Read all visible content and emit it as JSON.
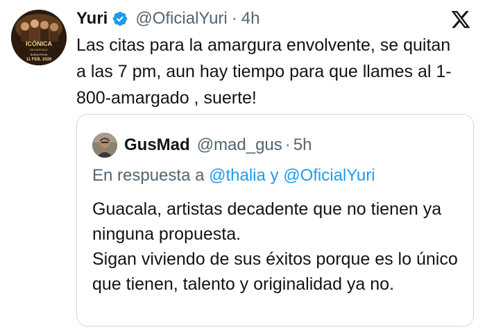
{
  "tweet": {
    "author_name": "Yuri",
    "author_handle": "@OficialYuri",
    "separator": "·",
    "time": "4h",
    "text": "Las citas para la amargura envolvente, se quitan a las 7 pm, aun hay tiempo para que llames al 1-800-amargado , suerte!",
    "avatar_text": {
      "line1": "ICÓNICA",
      "line2": "RECARGADO",
      "line3": "NUEVA FECHA",
      "line4": "11 FEB. 2026"
    },
    "verified_icon": "verified-badge-icon",
    "platform_icon": "x-logo-icon",
    "colors": {
      "verified": "#1d9bf0",
      "handle": "#536471",
      "text": "#0f1419"
    }
  },
  "quoted_tweet": {
    "author_name": "GusMad",
    "author_handle": "@mad_gus",
    "separator": "·",
    "time": "5h",
    "reply_prefix": "En respuesta a",
    "reply_mention_1": "@thalia",
    "reply_conjunction": "y",
    "reply_mention_2": "@OficialYuri",
    "text": "Guacala, artistas decadente que no tienen ya ninguna propuesta.\nSigan viviendo de sus éxitos porque es lo único que tienen, talento y originalidad ya no.",
    "colors": {
      "mention": "#1d9bf0",
      "border": "#cfd9de"
    }
  }
}
